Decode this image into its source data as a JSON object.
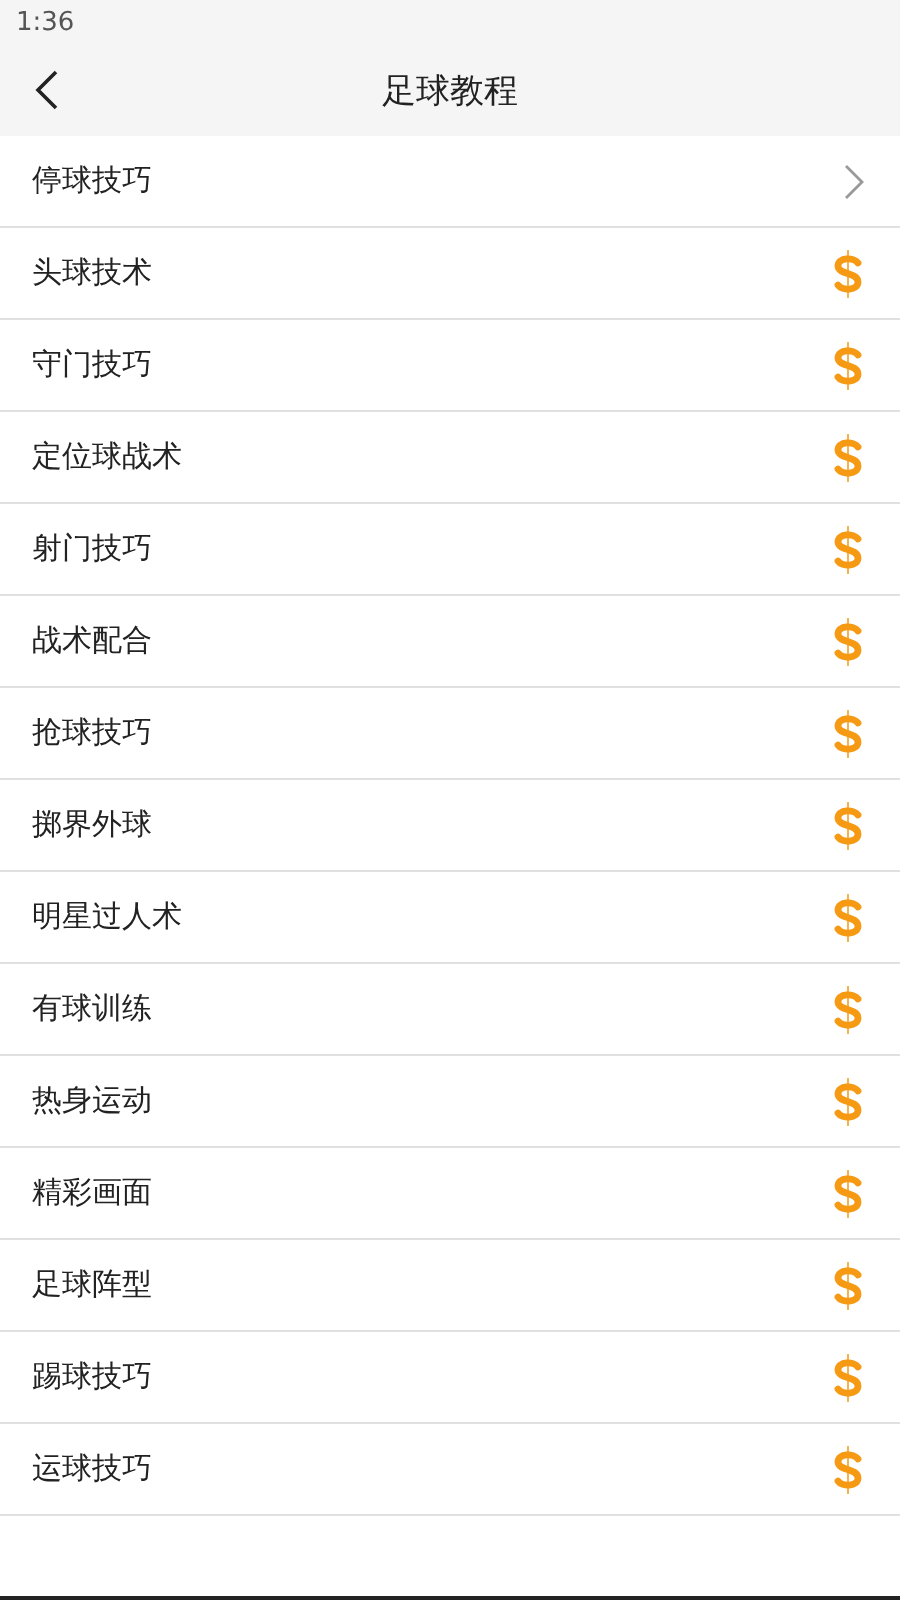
{
  "status_bar": {
    "time": "1:36"
  },
  "header": {
    "title": "足球教程"
  },
  "items": [
    {
      "label": "停球技巧",
      "kind": "free"
    },
    {
      "label": "头球技术",
      "kind": "paid"
    },
    {
      "label": "守门技巧",
      "kind": "paid"
    },
    {
      "label": "定位球战术",
      "kind": "paid"
    },
    {
      "label": "射门技巧",
      "kind": "paid"
    },
    {
      "label": "战术配合",
      "kind": "paid"
    },
    {
      "label": "抢球技巧",
      "kind": "paid"
    },
    {
      "label": "掷界外球",
      "kind": "paid"
    },
    {
      "label": "明星过人术",
      "kind": "paid"
    },
    {
      "label": "有球训练",
      "kind": "paid"
    },
    {
      "label": "热身运动",
      "kind": "paid"
    },
    {
      "label": "精彩画面",
      "kind": "paid"
    },
    {
      "label": "足球阵型",
      "kind": "paid"
    },
    {
      "label": "踢球技巧",
      "kind": "paid"
    },
    {
      "label": "运球技巧",
      "kind": "paid"
    }
  ]
}
